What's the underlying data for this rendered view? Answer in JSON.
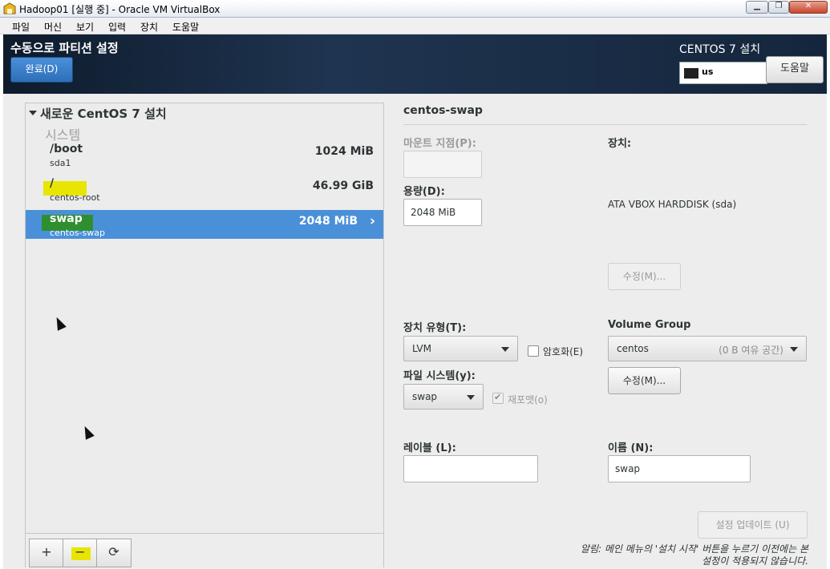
{
  "window": {
    "title": "Hadoop01 [실행 중] - Oracle VM VirtualBox",
    "controls": [
      "minimize",
      "restore",
      "close"
    ]
  },
  "menubar": [
    "파일",
    "머신",
    "보기",
    "입력",
    "장치",
    "도움말"
  ],
  "header": {
    "page_title": "수동으로 파티션 설정",
    "done_label": "완료(D)",
    "product_title": "CENTOS 7 설치",
    "keyboard_layout": "us",
    "help_label": "도움말"
  },
  "tree": {
    "root_label": "새로운 CentOS 7 설치",
    "section_label": "시스템",
    "partitions": [
      {
        "mount": "/boot",
        "device": "sda1",
        "size": "1024 MiB",
        "selected": false
      },
      {
        "mount": "/",
        "device": "centos-root",
        "size": "46.99 GiB",
        "selected": false
      },
      {
        "mount": "swap",
        "device": "centos-swap",
        "size": "2048 MiB",
        "selected": true
      }
    ],
    "toolbar": {
      "add": "+",
      "remove": "−",
      "refresh": "⟳"
    }
  },
  "details": {
    "title": "centos-swap",
    "mount_point_label": "마운트 지점(P):",
    "mount_point_value": "",
    "capacity_label": "용량(D):",
    "capacity_value": "2048 MiB",
    "device_label": "장치:",
    "device_value": "ATA VBOX HARDDISK (sda)",
    "modify_device_label": "수정(M)...",
    "device_type_label": "장치 유형(T):",
    "device_type_value": "LVM",
    "encrypt_label": "암호화(E)",
    "encrypt_checked": false,
    "volume_group_label": "Volume Group",
    "volume_group_value": "centos",
    "volume_group_free": "(0 B 여유 공간)",
    "modify_vg_label": "수정(M)...",
    "filesystem_label": "파일 시스템(y):",
    "filesystem_value": "swap",
    "reformat_label": "재포맷(o)",
    "reformat_checked": true,
    "label_label": "레이블 (L):",
    "label_value": "",
    "name_label": "이름 (N):",
    "name_value": "swap",
    "update_label": "설정 업데이트 (U)",
    "note_line1": "알림: 메인 메뉴의 '설치 시작' 버튼을 누르기 이전에는 본",
    "note_line2": "설정이 적용되지 않습니다."
  },
  "colors": {
    "header_bg": "#15263c",
    "accent": "#4a90d9",
    "highlight_yellow": "#e8e600",
    "highlight_green": "#2f8f2f"
  }
}
